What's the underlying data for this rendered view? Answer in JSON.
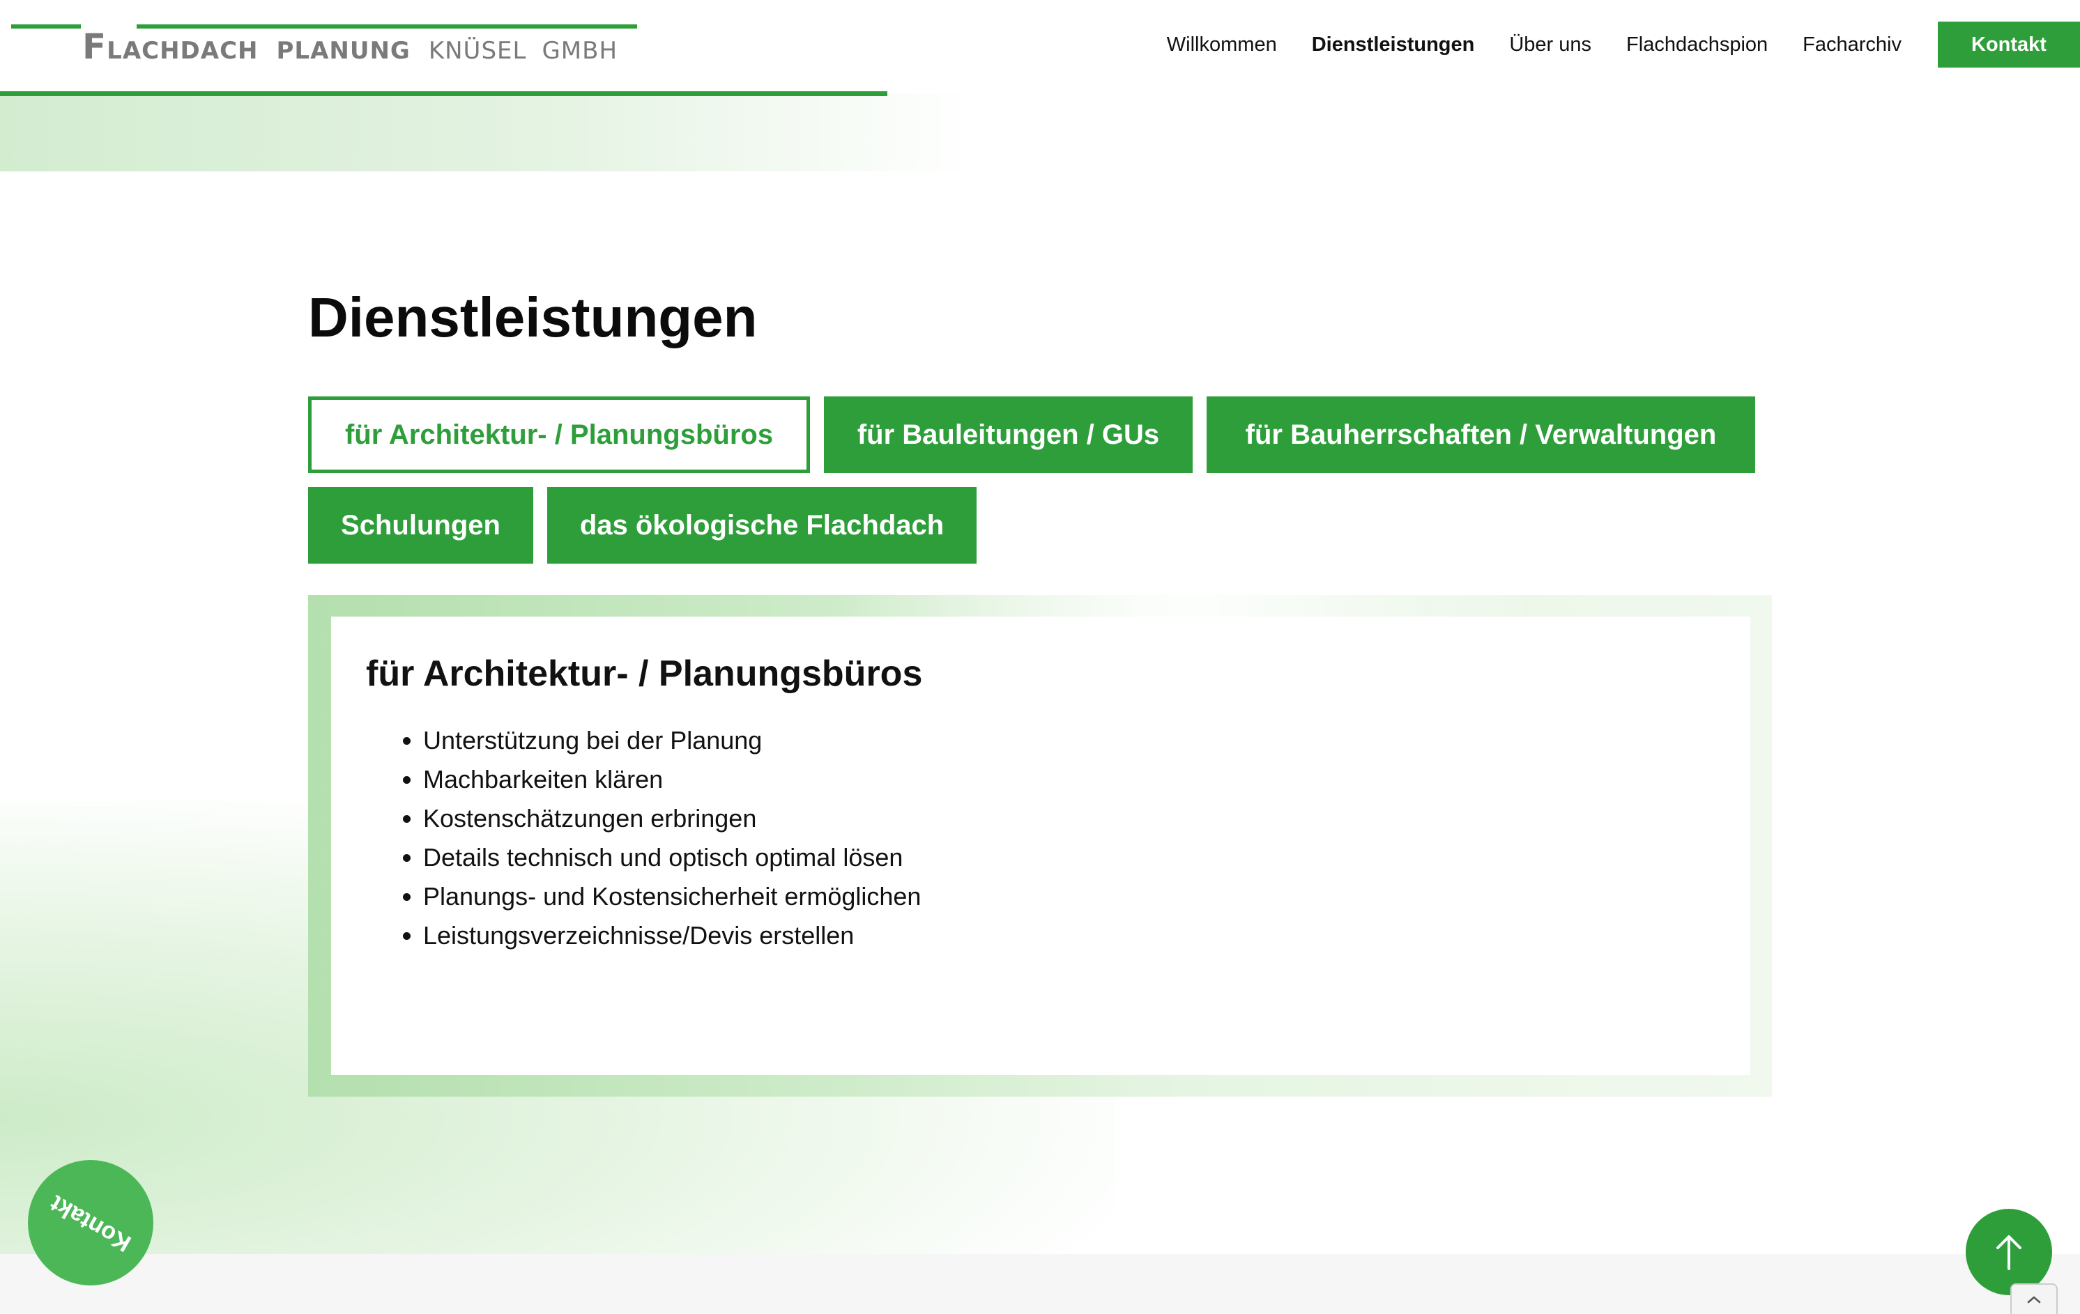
{
  "brand": {
    "logo_first_letter": "F",
    "logo_word1_rest": "LACHDACH",
    "logo_word2": "PLANUNG",
    "logo_word3": "KNÜSEL",
    "logo_word4": "GMBH",
    "color_primary": "#2e9e3a",
    "color_logo_text": "#7a7a7a"
  },
  "nav": {
    "items": [
      {
        "label": "Willkommen",
        "active": false
      },
      {
        "label": "Dienstleistungen",
        "active": true
      },
      {
        "label": "Über uns",
        "active": false
      },
      {
        "label": "Flachdachspion",
        "active": false
      },
      {
        "label": "Facharchiv",
        "active": false
      }
    ],
    "contact_label": "Kontakt"
  },
  "main": {
    "title": "Dienstleistungen",
    "tabs": [
      {
        "label": "für Architektur- / Planungsbüros",
        "active": true
      },
      {
        "label": "für Bauleitungen / GUs",
        "active": false
      },
      {
        "label": "für Bauherrschaften / Verwaltungen",
        "active": false
      },
      {
        "label": "Schulungen",
        "active": false
      },
      {
        "label": "das ökologische Flachdach",
        "active": false
      }
    ],
    "panel": {
      "heading": "für Architektur- / Planungsbüros",
      "items": [
        "Unterstützung bei der Planung",
        "Machbarkeiten klären",
        "Kostenschätzungen erbringen",
        "Details technisch und optisch optimal lösen",
        "Planungs- und Kostensicherheit ermöglichen",
        "Leistungsverzeichnisse/Devis erstellen"
      ]
    }
  },
  "floating": {
    "contact_circle_label": "Kontakt",
    "scroll_top_icon": "arrow-up-icon",
    "mini_scroll_icon": "chevron-up-icon"
  }
}
